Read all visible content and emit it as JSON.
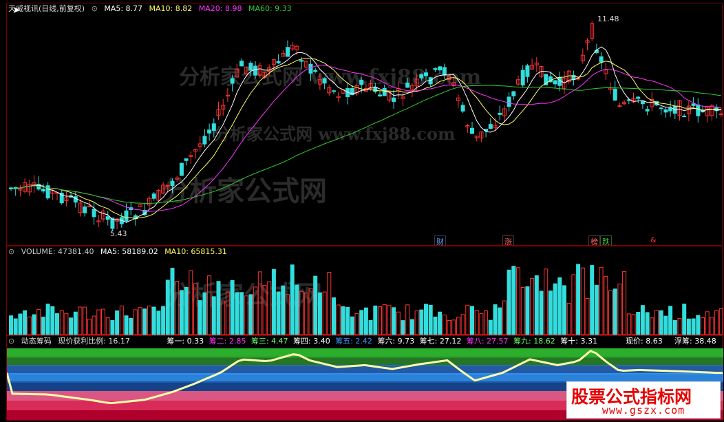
{
  "main": {
    "title": "天威视讯(日线,前复权)",
    "ma": [
      {
        "label": "MA5: 8.77",
        "color": "#ffffff"
      },
      {
        "label": "MA10: 8.82",
        "color": "#ffff66"
      },
      {
        "label": "MA20: 8.98",
        "color": "#ff33ff"
      },
      {
        "label": "MA60: 9.33",
        "color": "#33cc33"
      }
    ],
    "high_label": "11.48",
    "low_label": "5.43",
    "tags": [
      {
        "text": "财",
        "color": "#66aaff"
      },
      {
        "text": "涨",
        "color": "#ff6666"
      },
      {
        "text": "榜",
        "color": "#ff6666"
      },
      {
        "text": "跌",
        "color": "#33cc33"
      },
      {
        "text": "&",
        "color": "#ff3333"
      }
    ],
    "watermarks": [
      "分析家公式网 www.fxj88.com",
      "分析家公式网 www.fxj88.com",
      "分析家公式网"
    ]
  },
  "volume": {
    "items": [
      {
        "label": "VOLUME: 47381.40",
        "color": "#cccccc"
      },
      {
        "label": "MA5: 58189.02",
        "color": "#ffffff"
      },
      {
        "label": "MA10: 65815.31",
        "color": "#ffff66"
      }
    ],
    "watermark": "分析家公式网"
  },
  "chips": {
    "title": "动态筹码",
    "ratio": "现价获利比例: 16.17",
    "items": [
      {
        "label": "筹一: 0.33",
        "color": "#ffffff"
      },
      {
        "label": "筹二: 2.85",
        "color": "#ff33ff"
      },
      {
        "label": "筹三: 4.47",
        "color": "#66ff66"
      },
      {
        "label": "筹四: 3.40",
        "color": "#ffffff"
      },
      {
        "label": "筹五: 2.42",
        "color": "#3399ff"
      },
      {
        "label": "筹六: 9.73",
        "color": "#ffffff"
      },
      {
        "label": "筹七: 27.12",
        "color": "#ffffff"
      },
      {
        "label": "筹八: 27.57",
        "color": "#ff33ff"
      },
      {
        "label": "筹九: 18.62",
        "color": "#66ff66"
      },
      {
        "label": "筹十: 3.31",
        "color": "#ffffff"
      }
    ],
    "price": "现价: 8.63",
    "float": "浮筹: 38.48"
  },
  "logo": {
    "title": "股票公式指标网",
    "url": "www.gszx.com"
  }
}
